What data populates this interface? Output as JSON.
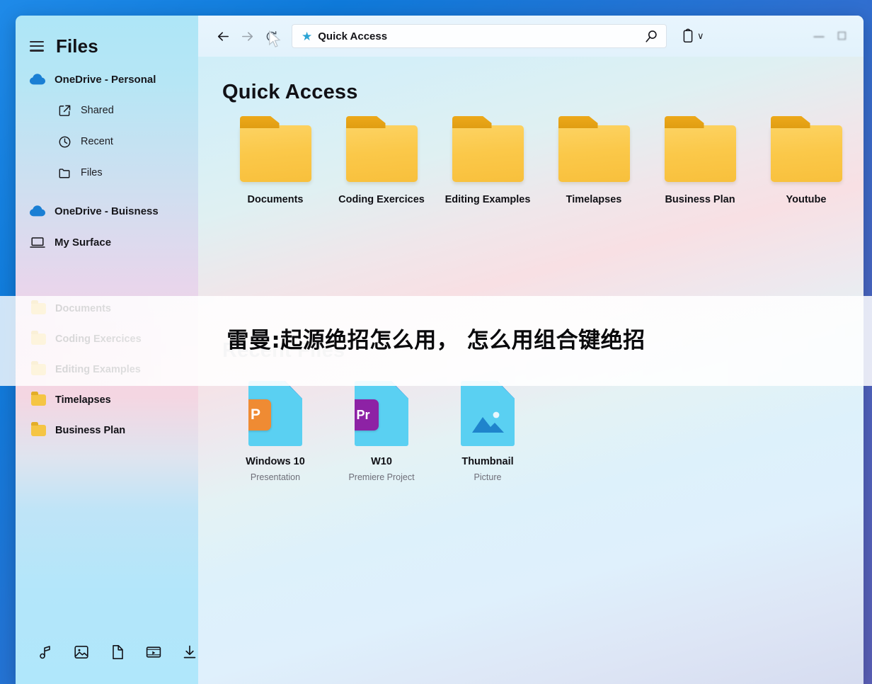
{
  "app": {
    "title": "Files",
    "menu_icon": "hamburger-icon"
  },
  "sidebar": {
    "accounts": [
      {
        "label": "OneDrive - Personal",
        "icon": "cloud-icon",
        "level": "top"
      },
      {
        "label": "Shared",
        "icon": "share-icon",
        "level": "sub"
      },
      {
        "label": "Recent",
        "icon": "clock-icon",
        "level": "sub"
      },
      {
        "label": "Files",
        "icon": "folder-outline-icon",
        "level": "sub"
      },
      {
        "label": "OneDrive - Buisness",
        "icon": "cloud-icon",
        "level": "top"
      },
      {
        "label": "My Surface",
        "icon": "laptop-icon",
        "level": "top"
      }
    ],
    "folders": [
      {
        "label": "Documents"
      },
      {
        "label": "Coding Exercices"
      },
      {
        "label": "Editing Examples"
      },
      {
        "label": "Timelapses"
      },
      {
        "label": "Business Plan"
      }
    ],
    "bottom_icons": [
      {
        "name": "music-icon",
        "glyph": "♪"
      },
      {
        "name": "pictures-icon",
        "glyph": "ὛC"
      },
      {
        "name": "documents-icon",
        "glyph": "Ὄ4"
      },
      {
        "name": "videos-icon",
        "glyph": "▶"
      },
      {
        "name": "downloads-icon",
        "glyph": "↓"
      }
    ]
  },
  "toolbar": {
    "back_label": "←",
    "forward_label": "→",
    "refresh_label": "↻",
    "address_value": "Quick Access",
    "address_star": "★",
    "search_icon": "search-icon",
    "clipboard_icon": "clipboard-icon",
    "chevron": "∨",
    "window_minimize": "—",
    "window_restore": "☐"
  },
  "main": {
    "quick_access_title": "Quick Access",
    "quick_access_items": [
      {
        "label": "Documents"
      },
      {
        "label": "Coding Exercices"
      },
      {
        "label": "Editing Examples"
      },
      {
        "label": "Timelapses"
      },
      {
        "label": "Business Plan"
      },
      {
        "label": "Youtube"
      }
    ],
    "recent_title": "Recent Files",
    "recent_items": [
      {
        "name": "Windows 10",
        "type": "Presentation",
        "badge": "P",
        "badge_color": "#ef8b33"
      },
      {
        "name": "W10",
        "type": "Premiere Project",
        "badge": "Pr",
        "badge_color": "#8d22a5"
      },
      {
        "name": "Thumbnail",
        "type": "Picture",
        "badge": "",
        "badge_color": ""
      }
    ]
  },
  "overlay": {
    "text": "雷曼:起源绝招怎么用， 怎么用组合键绝招"
  },
  "colors": {
    "desktop_blue": "#0f7ada",
    "folder_yellow": "#fbc849",
    "folder_tab": "#e09d12",
    "file_cyan": "#5ad0f2",
    "star_blue": "#2aa3d4"
  }
}
